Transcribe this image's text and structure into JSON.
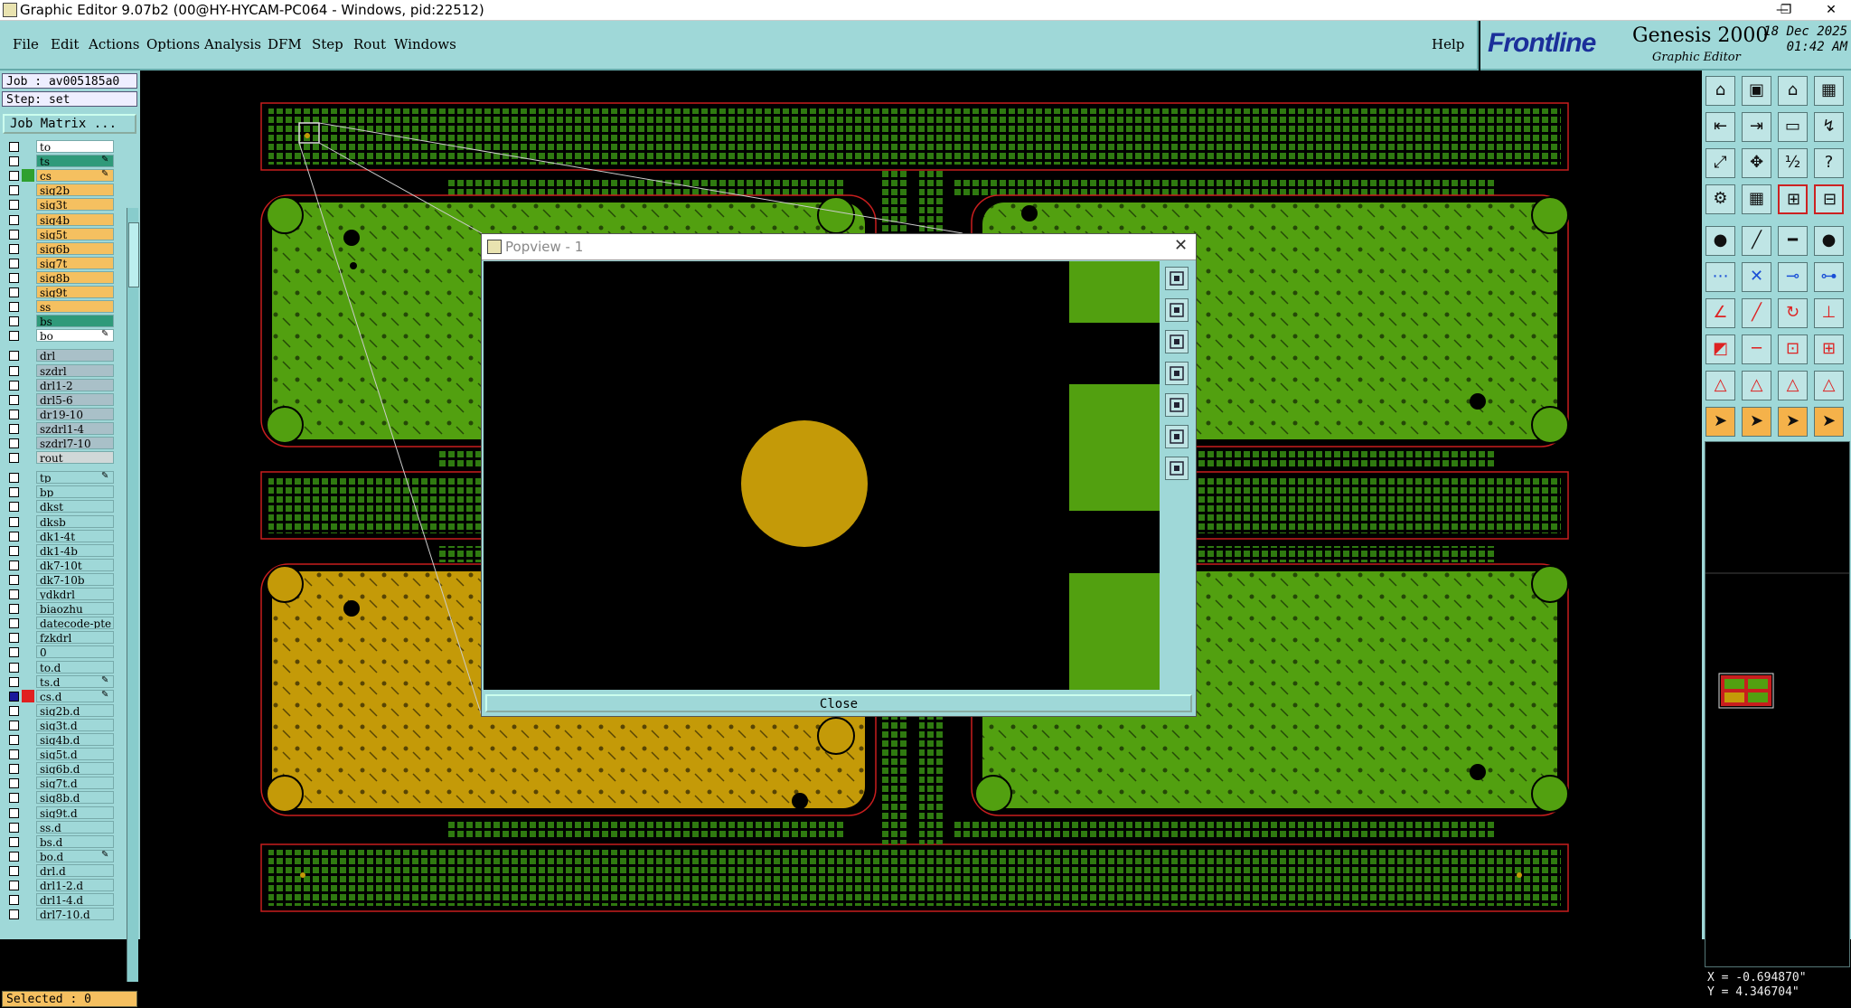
{
  "window": {
    "title": "Graphic Editor 9.07b2 (00@HY-HYCAM-PC064 - Windows, pid:22512)",
    "minimize": "—",
    "restore": "❐",
    "close": "✕"
  },
  "menu": {
    "items": [
      "File",
      "Edit",
      "Actions",
      "Options",
      "Analysis",
      "DFM",
      "Step",
      "Rout",
      "Windows"
    ],
    "help": "Help"
  },
  "brand": {
    "logo": "Frontline",
    "product": "Genesis 2000",
    "subtitle": "Graphic Editor",
    "date": "18 Dec 2025",
    "time": "01:42 AM"
  },
  "job": {
    "job_label": "Job : av005185a0",
    "step_label": "Step: set",
    "matrix_button": "Job Matrix ..."
  },
  "layers": [
    {
      "name": "to",
      "color": "#ffffff",
      "pen": false,
      "checked": false
    },
    {
      "name": "ts",
      "color": "#2f9a7a",
      "pen": true,
      "checked": false
    },
    {
      "name": "cs",
      "color": "#f5c060",
      "pen": true,
      "checked": false,
      "indicator": "#2fa02f"
    },
    {
      "name": "sig2b",
      "color": "#f5c060",
      "pen": false,
      "checked": false
    },
    {
      "name": "sig3t",
      "color": "#f5c060",
      "pen": false,
      "checked": false
    },
    {
      "name": "sig4b",
      "color": "#f5c060",
      "pen": false,
      "checked": false
    },
    {
      "name": "sig5t",
      "color": "#f5c060",
      "pen": false,
      "checked": false
    },
    {
      "name": "sig6b",
      "color": "#f5c060",
      "pen": false,
      "checked": false
    },
    {
      "name": "sig7t",
      "color": "#f5c060",
      "pen": false,
      "checked": false
    },
    {
      "name": "sig8b",
      "color": "#f5c060",
      "pen": false,
      "checked": false
    },
    {
      "name": "sig9t",
      "color": "#f5c060",
      "pen": false,
      "checked": false
    },
    {
      "name": "ss",
      "color": "#f5c060",
      "pen": false,
      "checked": false
    },
    {
      "name": "bs",
      "color": "#2f9a7a",
      "pen": false,
      "checked": false
    },
    {
      "name": "bo",
      "color": "#ffffff",
      "pen": true,
      "checked": false
    },
    {
      "name": "drl",
      "color": "#a9c0c8",
      "pen": false,
      "checked": false
    },
    {
      "name": "szdrl",
      "color": "#a9c0c8",
      "pen": false,
      "checked": false
    },
    {
      "name": "drl1-2",
      "color": "#a9c0c8",
      "pen": false,
      "checked": false
    },
    {
      "name": "drl5-6",
      "color": "#a9c0c8",
      "pen": false,
      "checked": false
    },
    {
      "name": "dr19-10",
      "color": "#a9c0c8",
      "pen": false,
      "checked": false
    },
    {
      "name": "szdrl1-4",
      "color": "#a9c0c8",
      "pen": false,
      "checked": false
    },
    {
      "name": "szdrl7-10",
      "color": "#a9c0c8",
      "pen": false,
      "checked": false
    },
    {
      "name": "rout",
      "color": "#d0d8d8",
      "pen": false,
      "checked": false
    },
    {
      "name": "tp",
      "color": "#9fd8d8",
      "pen": true,
      "checked": false
    },
    {
      "name": "bp",
      "color": "#9fd8d8",
      "pen": false,
      "checked": false
    },
    {
      "name": "dkst",
      "color": "#9fd8d8",
      "pen": false,
      "checked": false
    },
    {
      "name": "dksb",
      "color": "#9fd8d8",
      "pen": false,
      "checked": false
    },
    {
      "name": "dk1-4t",
      "color": "#9fd8d8",
      "pen": false,
      "checked": false
    },
    {
      "name": "dk1-4b",
      "color": "#9fd8d8",
      "pen": false,
      "checked": false
    },
    {
      "name": "dk7-10t",
      "color": "#9fd8d8",
      "pen": false,
      "checked": false
    },
    {
      "name": "dk7-10b",
      "color": "#9fd8d8",
      "pen": false,
      "checked": false
    },
    {
      "name": "ydkdrl",
      "color": "#9fd8d8",
      "pen": false,
      "checked": false
    },
    {
      "name": "biaozhu",
      "color": "#9fd8d8",
      "pen": false,
      "checked": false
    },
    {
      "name": "datecode-pte",
      "color": "#9fd8d8",
      "pen": false,
      "checked": false
    },
    {
      "name": "fzkdrl",
      "color": "#9fd8d8",
      "pen": false,
      "checked": false
    },
    {
      "name": "0",
      "color": "#9fd8d8",
      "pen": false,
      "checked": false
    },
    {
      "name": "to.d",
      "color": "#9fd8d8",
      "pen": false,
      "checked": false
    },
    {
      "name": "ts.d",
      "color": "#9fd8d8",
      "pen": true,
      "checked": false
    },
    {
      "name": "cs.d",
      "color": "#9fd8d8",
      "pen": true,
      "checked": true,
      "indicator": "#e02020"
    },
    {
      "name": "sig2b.d",
      "color": "#9fd8d8",
      "pen": false,
      "checked": false
    },
    {
      "name": "sig3t.d",
      "color": "#9fd8d8",
      "pen": false,
      "checked": false
    },
    {
      "name": "sig4b.d",
      "color": "#9fd8d8",
      "pen": false,
      "checked": false
    },
    {
      "name": "sig5t.d",
      "color": "#9fd8d8",
      "pen": false,
      "checked": false
    },
    {
      "name": "sig6b.d",
      "color": "#9fd8d8",
      "pen": false,
      "checked": false
    },
    {
      "name": "sig7t.d",
      "color": "#9fd8d8",
      "pen": false,
      "checked": false
    },
    {
      "name": "sig8b.d",
      "color": "#9fd8d8",
      "pen": false,
      "checked": false
    },
    {
      "name": "sig9t.d",
      "color": "#9fd8d8",
      "pen": false,
      "checked": false
    },
    {
      "name": "ss.d",
      "color": "#9fd8d8",
      "pen": false,
      "checked": false
    },
    {
      "name": "bs.d",
      "color": "#9fd8d8",
      "pen": false,
      "checked": false
    },
    {
      "name": "bo.d",
      "color": "#9fd8d8",
      "pen": true,
      "checked": false
    },
    {
      "name": "drl.d",
      "color": "#9fd8d8",
      "pen": false,
      "checked": false
    },
    {
      "name": "drl1-2.d",
      "color": "#9fd8d8",
      "pen": false,
      "checked": false
    },
    {
      "name": "drl1-4.d",
      "color": "#9fd8d8",
      "pen": false,
      "checked": false
    },
    {
      "name": "drl7-10.d",
      "color": "#9fd8d8",
      "pen": false,
      "checked": false
    }
  ],
  "status": {
    "selected": "Selected : 0",
    "x": "X = -0.694870\"",
    "y": "Y = 4.346704\""
  },
  "popview": {
    "title": "Popview - 1",
    "close_icon": "✕",
    "close_button": "Close",
    "tools": [
      "zoom-window-icon",
      "zoom-in-icon",
      "zoom-out-icon",
      "pan-left-icon",
      "pan-right-icon",
      "fit-icon",
      "center-icon"
    ]
  },
  "colors": {
    "panel": "#9fd8d8",
    "pcb_green": "#52a010",
    "pcb_gold": "#c49a08",
    "outline_red": "#c81e1e",
    "pad_green": "#2f7a10"
  },
  "toolbar": {
    "icons": [
      "home-icon",
      "save-icon",
      "house-icon",
      "grid-view-icon",
      "import-icon",
      "export-icon",
      "layer-icon",
      "route-icon",
      "fit-screen-icon",
      "move-icon",
      "scale-icon",
      "help-icon",
      "tool-settings-icon",
      "grid-icon",
      "snap-icon",
      "measure-icon",
      "pad-icon",
      "line-icon",
      "ruler-icon",
      "circle-icon",
      "connect-icon",
      "cross-icon",
      "node-icon",
      "link-icon",
      "angle-icon",
      "slash-icon",
      "arc-icon",
      "split-icon",
      "square-icon",
      "dash-icon",
      "frame-icon",
      "component-icon",
      "triangle-icon",
      "triangle-a-icon",
      "triangle-b-icon",
      "triangle-c-icon",
      "pointer-icon",
      "pointer-select-icon",
      "pointer-edit-icon",
      "pointer-group-icon"
    ]
  }
}
